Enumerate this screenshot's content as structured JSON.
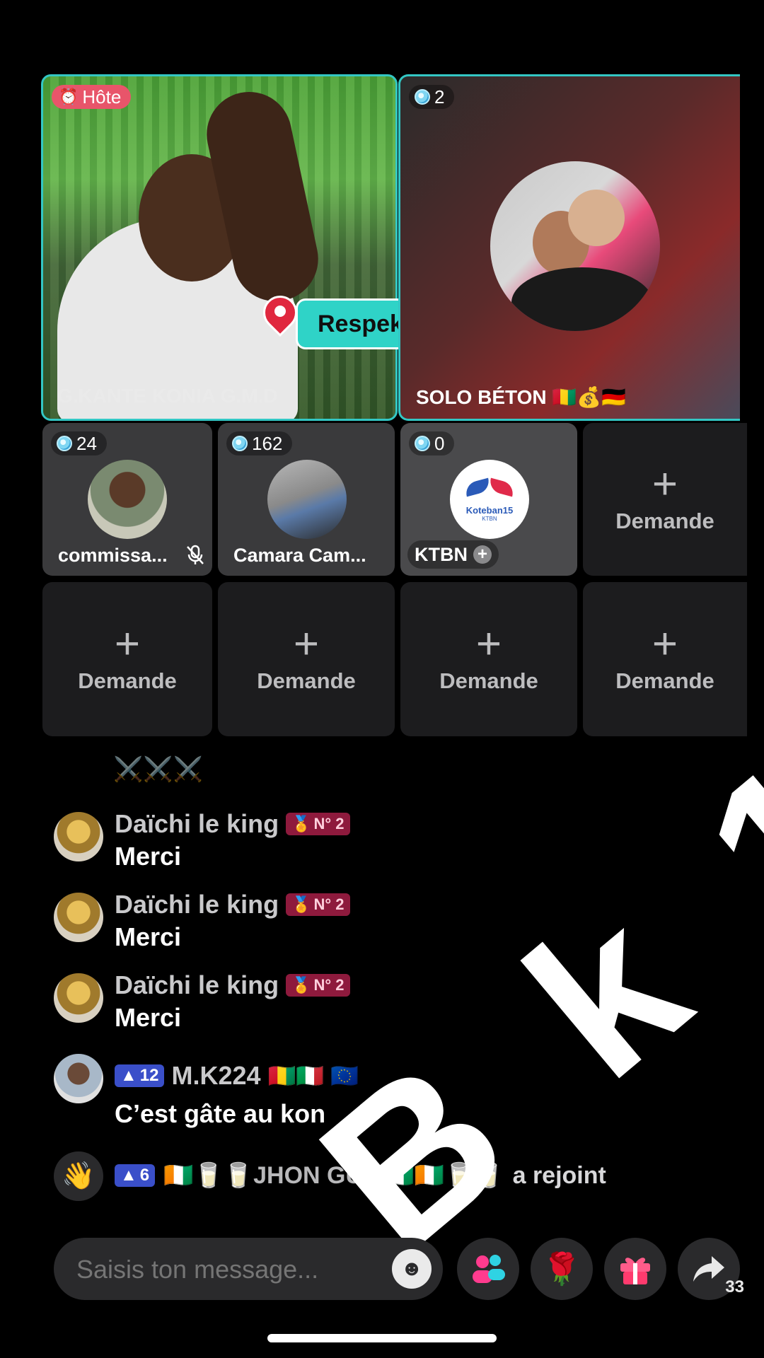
{
  "host_tile": {
    "badge": "Hôte",
    "name": "G.KANTE KONIA G.M.D",
    "sticker": "Respekt et fierté/"
  },
  "guest_tile": {
    "count": "2",
    "name": "SOLO BÉTON 🇬🇳💰🇩🇪"
  },
  "seats": [
    {
      "count": "24",
      "name": "commissa..."
    },
    {
      "count": "162",
      "name": "Camara Cam..."
    },
    {
      "count": "0",
      "name": "KTBN",
      "logo_text": "Koteban15",
      "logo_sub": "KTBN"
    }
  ],
  "request_label": "Demande",
  "chat": {
    "top_fragment": "⚔️⚔️⚔️",
    "messages": [
      {
        "user": "Daïchi le king",
        "badge": "N° 2",
        "text": "Merci"
      },
      {
        "user": "Daïchi le king",
        "badge": "N° 2",
        "text": "Merci"
      },
      {
        "user": "Daïchi le king",
        "badge": "N° 2",
        "text": "Merci"
      },
      {
        "user": "M.K224",
        "level": "12",
        "flags": "🇬🇳🇮🇹 🇪🇺",
        "text": "C’est gâte au kon"
      }
    ],
    "join": {
      "level": "6",
      "user": "🇨🇮🥛🥛JHON GUTI🇨🇮🇨🇮🥛🥛",
      "action": "a rejoint"
    }
  },
  "watermark": "B k 1",
  "composer": {
    "placeholder": "Saisis ton message..."
  },
  "share_count": "33",
  "colors": {
    "accent": "#33c7c4",
    "host_badge": "#e8556a",
    "rank_badge": "#8e1a3d",
    "level_badge": "#3a4fc9"
  },
  "icons": [
    "emoji-icon",
    "guests-icon",
    "rose-icon",
    "gift-icon",
    "share-icon",
    "mic-muted-icon",
    "wave-icon"
  ]
}
